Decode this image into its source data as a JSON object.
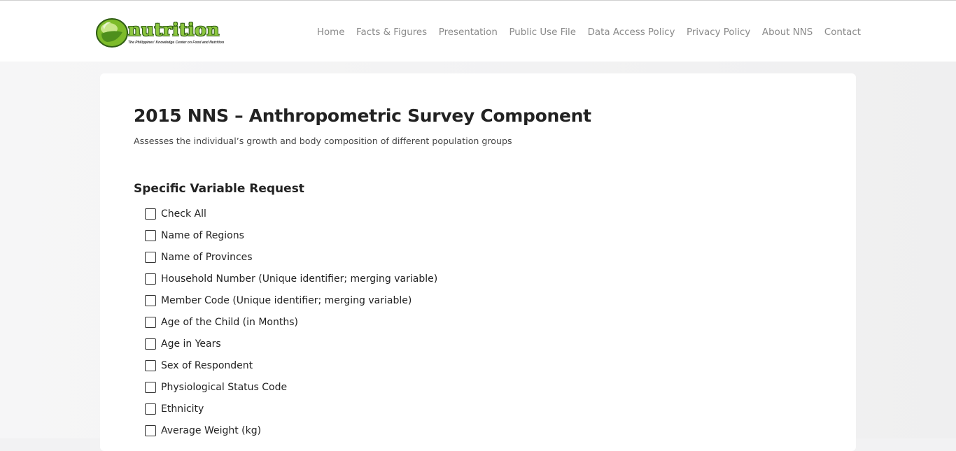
{
  "header": {
    "logo": {
      "word": "nutrition",
      "tagline": "The Philippines' Knowledge Center on Food and Nutrition"
    },
    "nav": [
      "Home",
      "Facts & Figures",
      "Presentation",
      "Public Use File",
      "Data Access Policy",
      "Privacy Policy",
      "About NNS",
      "Contact"
    ]
  },
  "page": {
    "title": "2015 NNS – Anthropometric Survey Component",
    "subtitle": "Assesses the individual’s growth and body composition of different population groups"
  },
  "variables": {
    "section_title": "Specific Variable Request",
    "items": [
      {
        "label": "Check All",
        "checked": false
      },
      {
        "label": "Name of Regions",
        "checked": false
      },
      {
        "label": "Name of Provinces",
        "checked": false
      },
      {
        "label": "Household Number (Unique identifier; merging variable)",
        "checked": false
      },
      {
        "label": "Member Code (Unique identifier; merging variable)",
        "checked": false
      },
      {
        "label": "Age of the Child (in Months)",
        "checked": false
      },
      {
        "label": "Age in Years",
        "checked": false
      },
      {
        "label": "Sex of Respondent",
        "checked": false
      },
      {
        "label": "Physiological Status Code",
        "checked": false
      },
      {
        "label": "Ethnicity",
        "checked": false
      },
      {
        "label": "Average Weight (kg)",
        "checked": false
      }
    ]
  },
  "colors": {
    "logo_green": "#8cc63f",
    "nav_text": "#8a8a8a",
    "background": "#f2f2f3"
  }
}
